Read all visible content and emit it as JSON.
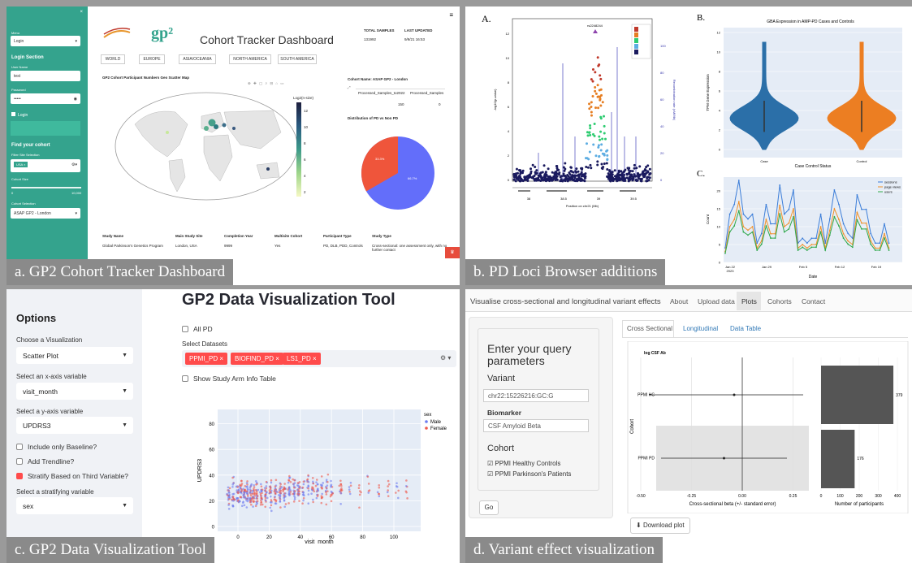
{
  "panel_a": {
    "caption": "a. GP2 Cohort Tracker Dashboard",
    "logo": "gp²",
    "title": "Cohort Tracker Dashboard",
    "stats": {
      "total_label": "TOTAL SAMPLES",
      "total_value": "131992",
      "updated_label": "LAST UPDATED",
      "updated_value": "9/9/21 16:53"
    },
    "sidebar": {
      "menu_label": "Menu",
      "menu_value": "Login",
      "login_section": "Login Section",
      "username_label": "User Name",
      "username_value": "test",
      "password_label": "Password",
      "password_value": "•••••",
      "login_check": "Login",
      "find_cohort": "Find your cohort",
      "filter_label": "Filter Site Selection",
      "filter_chip": "USA ×",
      "slider_label": "Cohort Size",
      "slider_min": "0",
      "slider_max": "10,000",
      "cohort_label": "Cohort Selection",
      "cohort_value": "ASAP GP2 - London"
    },
    "regions": [
      "WORLD",
      "EUROPE",
      "ASIA/OCEANIA",
      "NORTH AMERICA",
      "SOUTH AMERICA"
    ],
    "map_title": "GP2 Cohort Participant Numbers Geo Scatter Map",
    "colorbar_title": "Log2(n-size)",
    "colorbar_ticks": [
      "12",
      "10",
      "8",
      "6",
      "4",
      "2"
    ],
    "cohort_name": "Cohort Name: ASAP GP2 - London",
    "table_headers": [
      "Processed_Samples_to2022",
      "Processed_Samples"
    ],
    "table_values": [
      "150",
      "0"
    ],
    "pie_title": "Distribution of PD vs Non PD",
    "pie_labels": [
      "66.7%",
      "33.3%"
    ],
    "info": {
      "headers": [
        "Study Name",
        "Main Study Site",
        "Completion Year",
        "Multisite Cohort",
        "Participant Type",
        "Study Type"
      ],
      "values": [
        "Global Parkinson's Genetics Program",
        "London, USA",
        "9999",
        "Yes",
        "PD, DLB, PDD, Controls",
        "Cross-sectional: one assessment only, with no further contact"
      ]
    }
  },
  "panel_b": {
    "caption": "b. PD Loci Browser additions",
    "label_a": "A.",
    "label_b": "B.",
    "label_c": "C.",
    "snp_label": "rs2248244",
    "x_axis": "Position on chr21 (Mb)",
    "y_left": "-log10(p-value)",
    "y_right": "Recombination rate (cM/Mb)",
    "x_ticks": [
      "38",
      "38.5",
      "39",
      "39.5"
    ],
    "violin_title": "GBA Expression in AMP-PD Cases and Controls",
    "violin_ylabel": "TPM Gene Expression",
    "violin_xlabel": "Case Control Status",
    "violin_cats": [
      "Case",
      "Control"
    ],
    "violin_colors": [
      "#2b6fa8",
      "#ec7e22"
    ],
    "line_ylabel": "Count",
    "line_xlabel": "Date",
    "line_legend": [
      "sessions",
      "page views",
      "users"
    ],
    "line_colors": [
      "#3b7dd8",
      "#f09028",
      "#2ea84a"
    ],
    "line_xticks": [
      "Jan 22\n2023",
      "Jan 29",
      "Feb 5",
      "Feb 12",
      "Feb 19"
    ]
  },
  "panel_c": {
    "caption": "c. GP2 Data Visualization Tool",
    "title": "GP2 Data Visualization Tool",
    "options": "Options",
    "viz_label": "Choose a Visualization",
    "viz_value": "Scatter Plot",
    "x_label": "Select an x-axis variable",
    "x_value": "visit_month",
    "y_label": "Select a y-axis variable",
    "y_value": "UPDRS3",
    "chk_baseline": "Include only Baseline?",
    "chk_trend": "Add Trendline?",
    "chk_stratify": "Stratify Based on Third Variable?",
    "strat_label": "Select a stratifying variable",
    "strat_value": "sex",
    "all_pd": "All PD",
    "datasets_label": "Select Datasets",
    "datasets": [
      "PPMI_PD ×",
      "BIOFIND_PD ×",
      "LS1_PD ×"
    ],
    "study_arm": "Show Study Arm Info Table",
    "legend_title": "sex",
    "legend": [
      "Male",
      "Female"
    ],
    "legend_colors": [
      "#6c7cf0",
      "#ef5a4c"
    ],
    "xlabel": "visit_month",
    "ylabel": "UPDRS3",
    "x_ticks": [
      "0",
      "20",
      "40",
      "60",
      "80",
      "100"
    ],
    "y_ticks": [
      "0",
      "20",
      "40",
      "60",
      "80"
    ]
  },
  "panel_d": {
    "caption": "d. Variant effect visualization",
    "app_title": "Visualise cross-sectional and longitudinal variant effects",
    "nav": [
      "About",
      "Upload data",
      "Plots",
      "Cohorts",
      "Contact"
    ],
    "query_title": "Enter your query parameters",
    "variant_label": "Variant",
    "variant_value": "chr22:15226216:GC:G",
    "biomarker_label": "Biomarker",
    "biomarker_value": "CSF Amyloid Beta",
    "cohort_label": "Cohort",
    "cohorts": [
      "PPMI Healthy Controls",
      "PPMI Parkinson's Patients"
    ],
    "go": "Go",
    "tabs": [
      "Cross Sectional",
      "Longitudinal",
      "Data Table"
    ],
    "plot_title": "log CSF Ab",
    "y_label": "Cohort",
    "y_cats": [
      "PPMI HC",
      "PPMI PD"
    ],
    "x_label": "Cross-sectional beta (+/- standard error)",
    "x_ticks": [
      "-0.50",
      "-0.25",
      "0.00",
      "0.25"
    ],
    "bar_xlabel": "Number of participants",
    "bar_ticks": [
      "0",
      "100",
      "200",
      "300",
      "400"
    ],
    "bar_values": [
      379,
      176
    ],
    "download": "Download plot"
  }
}
